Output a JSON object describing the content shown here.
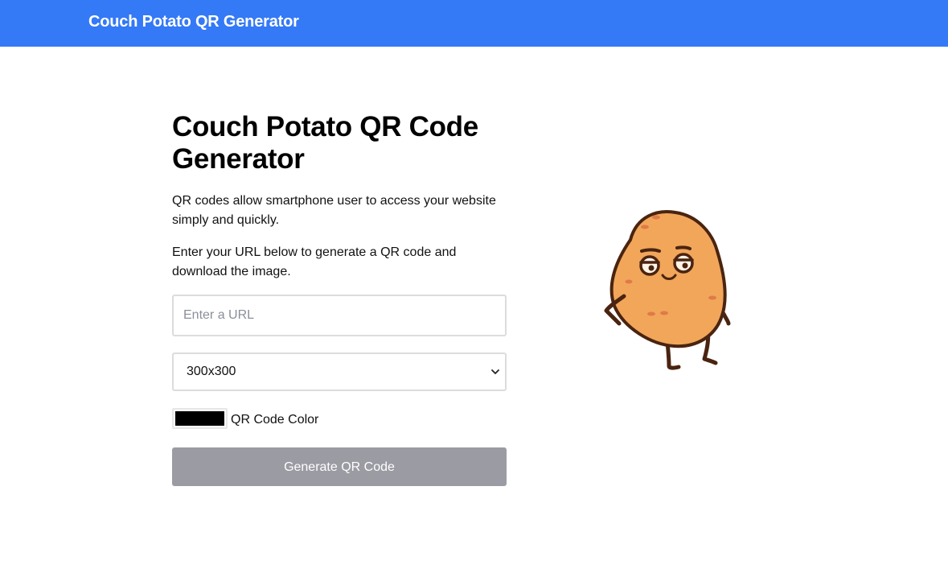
{
  "header": {
    "brand": "Couch Potato QR Generator"
  },
  "main": {
    "title": "Couch Potato QR Code Generator",
    "intro": "QR codes allow smartphone user to access your website simply and quickly.",
    "instructions": "Enter your URL below to generate a QR code and download the image.",
    "url_input": {
      "value": "",
      "placeholder": "Enter a URL"
    },
    "size_select": {
      "selected": "300x300"
    },
    "color_picker": {
      "value": "#000000",
      "label": "QR Code Color"
    },
    "generate_button": {
      "label": "Generate QR Code"
    }
  },
  "colors": {
    "header_bg": "#3479f6",
    "button_bg": "#9b9ba3",
    "qr_color": "#000000"
  },
  "icons": {
    "mascot": "couch-potato-mascot",
    "select_arrow": "chevron-down-icon"
  }
}
